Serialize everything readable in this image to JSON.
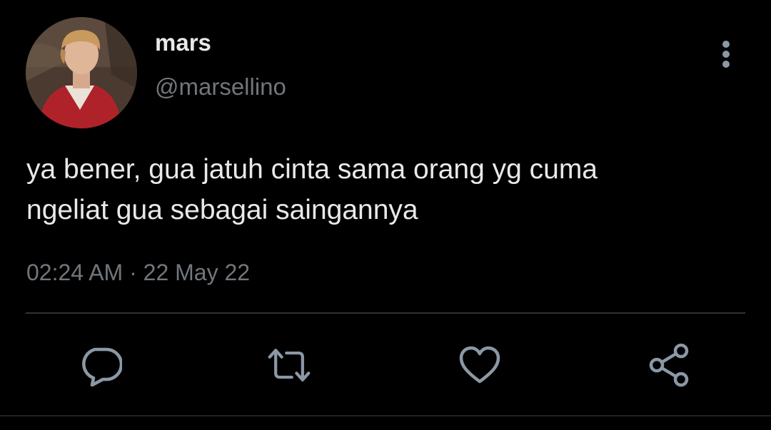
{
  "user": {
    "display_name": "mars",
    "handle": "@marsellino",
    "avatar_icon": "profile-photo"
  },
  "tweet": {
    "text_lines": [
      "ya bener, gua jatuh cinta sama orang yg cuma",
      "ngeliat gua sebagai saingannya"
    ],
    "timestamp": "02:24 AM · 22 May 22"
  },
  "actions": [
    {
      "name": "reply",
      "icon": "speech-bubble-icon"
    },
    {
      "name": "retweet",
      "icon": "retweet-arrows-icon"
    },
    {
      "name": "like",
      "icon": "heart-icon"
    },
    {
      "name": "share",
      "icon": "share-nodes-icon"
    }
  ],
  "colors": {
    "background": "#000000",
    "primary_text": "#e7e9ea",
    "secondary_text": "#71767b",
    "icon": "#8b98a5",
    "divider": "#2f3336"
  }
}
